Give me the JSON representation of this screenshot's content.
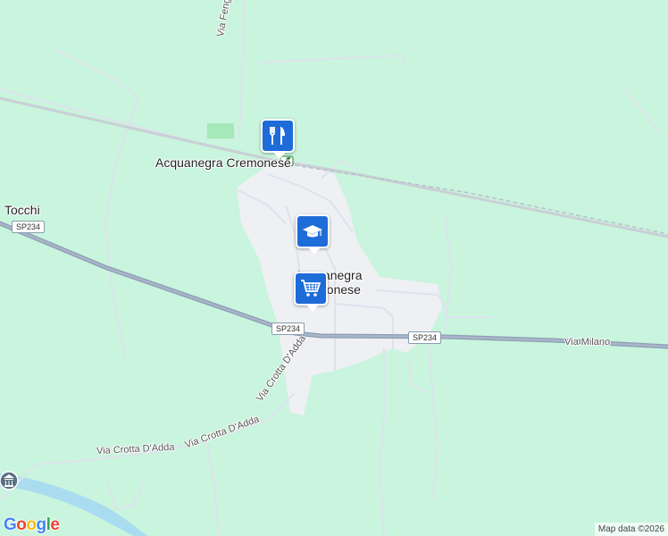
{
  "map": {
    "colors": {
      "land": "#c9f4dd",
      "urban": "#eef0f4",
      "road_major": "#8d9db5",
      "road_minor": "#dde3ec",
      "water": "#aadcf0",
      "pin": "#1e6cd8"
    },
    "labels": {
      "tocchi": "Tocchi",
      "acquanegra_station": "Acquanegra Cremonese",
      "town_line1": "Acquanegra",
      "town_line2": "Cremonese",
      "via_fengo": "Via Fengo",
      "via_milano": "Via Milano",
      "via_crotta_1": "Via Crotta D'Adda",
      "via_crotta_2": "Via Crotta D'Adda",
      "via_crotta_3": "Via Crotta D'Adda"
    },
    "shields": {
      "sp234_a": "SP234",
      "sp234_b": "SP234",
      "sp234_c": "SP234"
    },
    "pins": [
      {
        "name": "restaurant-pin",
        "icon": "fork-knife-icon"
      },
      {
        "name": "school-pin",
        "icon": "graduation-cap-icon"
      },
      {
        "name": "shopping-pin",
        "icon": "shopping-cart-icon"
      }
    ],
    "station_icon": "train-station-icon",
    "museum_icon": "museum-icon",
    "brand": {
      "g1": "G",
      "o1": "o",
      "o2": "o",
      "g2": "g",
      "l": "l",
      "e": "e"
    },
    "attribution": "Map data ©2026"
  }
}
